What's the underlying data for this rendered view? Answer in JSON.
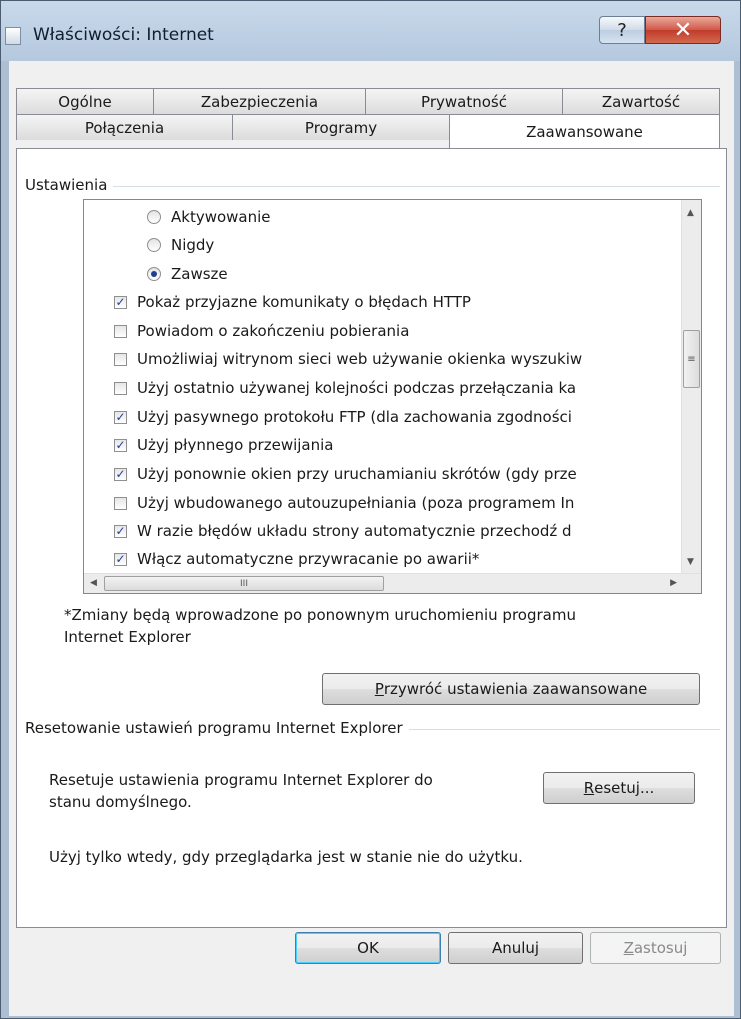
{
  "window": {
    "title": "Właściwości: Internet",
    "help_glyph": "?",
    "close_glyph": "✕"
  },
  "tabs_row1": [
    "Ogólne",
    "Zabezpieczenia",
    "Prywatność",
    "Zawartość"
  ],
  "tabs_row2": [
    "Połączenia",
    "Programy",
    "Zaawansowane"
  ],
  "active_tab": "Zaawansowane",
  "settings": {
    "group_label": "Ustawienia",
    "items": [
      {
        "type": "radio",
        "label": "Aktywowanie",
        "checked": false
      },
      {
        "type": "radio",
        "label": "Nigdy",
        "checked": false
      },
      {
        "type": "radio",
        "label": "Zawsze",
        "checked": true
      },
      {
        "type": "checkbox",
        "label": "Pokaż przyjazne komunikaty o błędach HTTP",
        "checked": true
      },
      {
        "type": "checkbox",
        "label": "Powiadom o zakończeniu pobierania",
        "checked": false
      },
      {
        "type": "checkbox",
        "label": "Umożliwiaj witrynom sieci web używanie okienka wyszukiw",
        "checked": false
      },
      {
        "type": "checkbox",
        "label": "Użyj ostatnio używanej kolejności podczas przełączania ka",
        "checked": false
      },
      {
        "type": "checkbox",
        "label": "Użyj pasywnego protokołu FTP (dla zachowania zgodności",
        "checked": true
      },
      {
        "type": "checkbox",
        "label": "Użyj płynnego przewijania",
        "checked": true
      },
      {
        "type": "checkbox",
        "label": "Użyj ponownie okien przy uruchamianiu skrótów (gdy prze",
        "checked": true
      },
      {
        "type": "checkbox",
        "label": "Użyj wbudowanego autouzupełniania (poza programem In",
        "checked": false
      },
      {
        "type": "checkbox",
        "label": "W razie błędów układu strony automatycznie przechodź d",
        "checked": true
      },
      {
        "type": "checkbox",
        "label": "Włącz automatyczne przywracanie po awarii*",
        "checked": true
      }
    ],
    "note_line1": "*Zmiany będą wprowadzone po ponownym uruchomieniu programu",
    "note_line2": "Internet Explorer",
    "restore_button_accel": "P",
    "restore_button_rest": "rzywróć ustawienia zaawansowane"
  },
  "reset": {
    "group_label": "Resetowanie ustawień programu Internet Explorer",
    "desc_line1": "Resetuje ustawienia programu Internet Explorer do",
    "desc_line2": "stanu domyślnego.",
    "button_accel": "R",
    "button_rest": "esetuj...",
    "note": "Użyj tylko wtedy, gdy przeglądarka jest w stanie nie do użytku."
  },
  "footer": {
    "ok": "OK",
    "cancel": "Anuluj",
    "apply_accel": "Z",
    "apply_rest": "astosuj"
  }
}
